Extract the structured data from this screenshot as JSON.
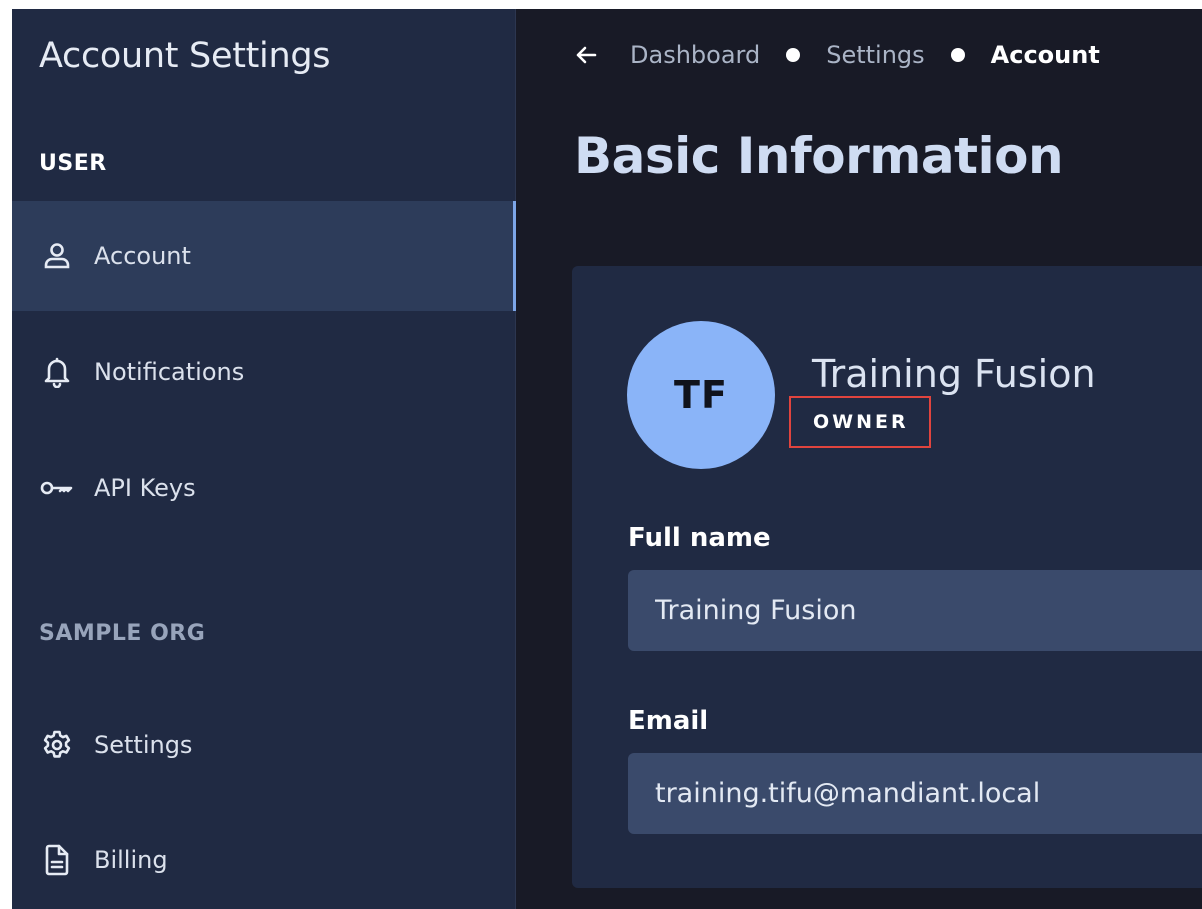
{
  "sidebar": {
    "title": "Account Settings",
    "sections": [
      {
        "label": "USER",
        "items": [
          {
            "label": "Account",
            "icon": "user-icon",
            "active": true
          },
          {
            "label": "Notifications",
            "icon": "bell-icon",
            "active": false
          },
          {
            "label": "API Keys",
            "icon": "key-icon",
            "active": false
          }
        ]
      },
      {
        "label": "SAMPLE ORG",
        "items": [
          {
            "label": "Settings",
            "icon": "gear-icon",
            "active": false
          },
          {
            "label": "Billing",
            "icon": "document-icon",
            "active": false
          }
        ]
      }
    ]
  },
  "breadcrumb": {
    "back_icon": "arrow-left-icon",
    "items": [
      "Dashboard",
      "Settings",
      "Account"
    ]
  },
  "page": {
    "title": "Basic Information"
  },
  "profile": {
    "initials": "TF",
    "name": "Training Fusion",
    "role": "OWNER"
  },
  "form": {
    "full_name": {
      "label": "Full name",
      "value": "Training Fusion"
    },
    "email": {
      "label": "Email",
      "value": "training.tifu@mandiant.local"
    }
  },
  "colors": {
    "sidebar_bg": "#202a43",
    "main_bg": "#181a26",
    "active_item_bg": "#2d3c5a",
    "avatar_bg": "#8ab4f8",
    "input_bg": "#3a4a6b",
    "highlight_border": "#e0443e"
  }
}
